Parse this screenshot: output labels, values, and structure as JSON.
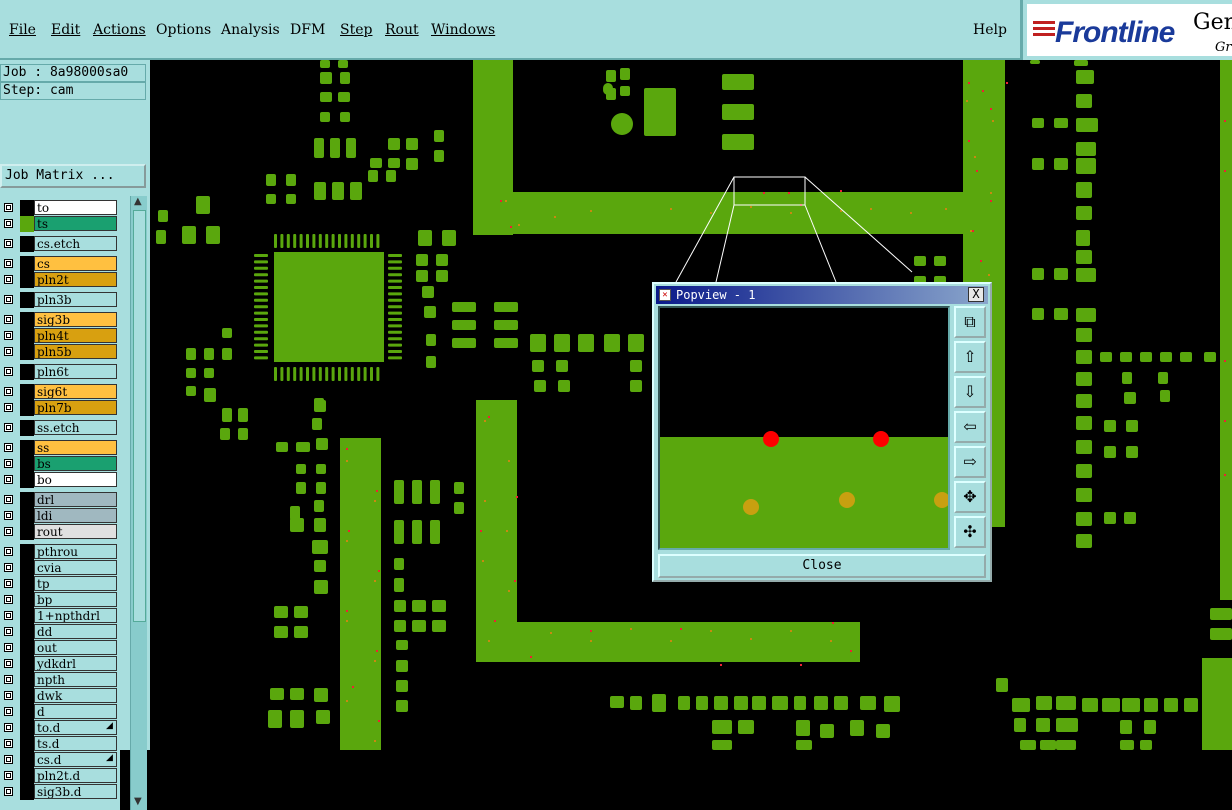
{
  "menu": {
    "file": "File",
    "edit": "Edit",
    "actions": "Actions",
    "options": "Options",
    "analysis": "Analysis",
    "dfm": "DFM",
    "step": "Step",
    "rout": "Rout",
    "windows": "Windows",
    "help": "Help"
  },
  "logo": {
    "brand": "Frontline",
    "product_partial": "Gen",
    "sub_partial": "Gr"
  },
  "job": {
    "job_label": "Job : 8a98000sa0",
    "step_label": "Step: cam",
    "matrix_button": "Job Matrix ..."
  },
  "layers": [
    {
      "name": "to",
      "color": "#ffffff"
    },
    {
      "name": "ts",
      "color": "#1aa070",
      "swatch": "#5aa70d"
    },
    {
      "name": "cs.etch",
      "color": "#a8dede"
    },
    {
      "name": "cs",
      "color": "#ffc040"
    },
    {
      "name": "pln2t",
      "color": "#d8a010"
    },
    {
      "name": "pln3b",
      "color": "#a8dede"
    },
    {
      "name": "sig3b",
      "color": "#ffc040"
    },
    {
      "name": "pln4t",
      "color": "#d8a010"
    },
    {
      "name": "pln5b",
      "color": "#d8a010"
    },
    {
      "name": "pln6t",
      "color": "#a8dede"
    },
    {
      "name": "sig6t",
      "color": "#ffc040"
    },
    {
      "name": "pln7b",
      "color": "#d8a010"
    },
    {
      "name": "ss.etch",
      "color": "#a8dede"
    },
    {
      "name": "ss",
      "color": "#ffc040"
    },
    {
      "name": "bs",
      "color": "#1aa070"
    },
    {
      "name": "bo",
      "color": "#ffffff"
    },
    {
      "name": "drl",
      "color": "#a0b8c0"
    },
    {
      "name": "ldi",
      "color": "#a0b8c0"
    },
    {
      "name": "rout",
      "color": "#e0e0e0"
    },
    {
      "name": "pthrou",
      "color": "#a8dede"
    },
    {
      "name": "cvia",
      "color": "#a8dede"
    },
    {
      "name": "tp",
      "color": "#a8dede"
    },
    {
      "name": "bp",
      "color": "#a8dede"
    },
    {
      "name": "1+npthdrl",
      "color": "#a8dede"
    },
    {
      "name": "dd",
      "color": "#a8dede"
    },
    {
      "name": "out",
      "color": "#a8dede"
    },
    {
      "name": "ydkdrl",
      "color": "#a8dede"
    },
    {
      "name": "npth",
      "color": "#a8dede"
    },
    {
      "name": "dwk",
      "color": "#a8dede"
    },
    {
      "name": "d",
      "color": "#a8dede"
    },
    {
      "name": "to.d",
      "color": "#a8dede",
      "mark": true
    },
    {
      "name": "ts.d",
      "color": "#a8dede"
    },
    {
      "name": "cs.d",
      "color": "#a8dede",
      "mark": true
    },
    {
      "name": "pln2t.d",
      "color": "#a8dede"
    },
    {
      "name": "sig3b.d",
      "color": "#a8dede"
    }
  ],
  "popview": {
    "title": "Popview - 1",
    "close_x": "X",
    "close_button": "Close"
  },
  "colors": {
    "pcb_copper": "#5aa70d",
    "ui_bg": "#a8dede",
    "drill_red": "#ff0000",
    "title_bar": "#0a1a8a"
  }
}
